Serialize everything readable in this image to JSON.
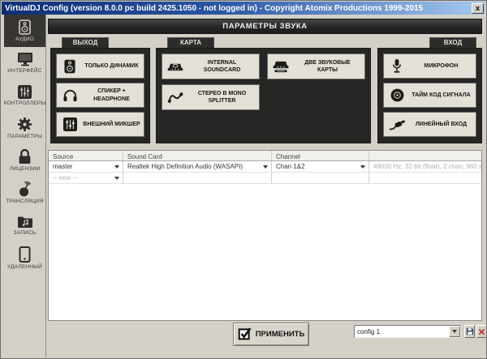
{
  "window": {
    "title": "VirtualDJ Config (version 8.0.0 pc build 2425.1050 - not logged in) - Copyright Atomix Productions 1999-2015",
    "close": "x"
  },
  "header": {
    "title": "ПАРАМЕТРЫ ЗВУКА"
  },
  "sidebar": {
    "items": [
      {
        "label": "АУДИО",
        "icon": "speaker-icon",
        "selected": true
      },
      {
        "label": "ИНТЕРФЕЙС",
        "icon": "monitor-icon",
        "selected": false
      },
      {
        "label": "КОНТРОЛЛЕРЫ",
        "icon": "mixer-icon",
        "selected": false
      },
      {
        "label": "ПАРАМЕТРЫ",
        "icon": "gear-icon",
        "selected": false
      },
      {
        "label": "ЛИЦЕНЗИИ",
        "icon": "lock-icon",
        "selected": false
      },
      {
        "label": "ТРАНСЛЯЦИЯ",
        "icon": "broadcast-icon",
        "selected": false
      },
      {
        "label": "ЗАПИСЬ",
        "icon": "record-icon",
        "selected": false
      },
      {
        "label": "УДАЛЕННЫЙ",
        "icon": "remote-icon",
        "selected": false
      }
    ]
  },
  "sections": {
    "output": {
      "tab": "ВЫХОД",
      "buttons": [
        {
          "label": "ТОЛЬКО ДИНАМИК",
          "icon": "speaker-icon"
        },
        {
          "label": "СПИКЕР +\nHEADPHONE",
          "icon": "headphone-icon"
        },
        {
          "label": "ВНЕШНИЙ МИКШЕР",
          "icon": "mixer-icon"
        }
      ]
    },
    "card": {
      "tab": "КАРТА",
      "buttons": [
        {
          "label": "INTERNAL\nSOUNDCARD",
          "icon": "soundcard-icon"
        },
        {
          "label": "ДВЕ ЗВУКОВЫЕ КАРТЫ",
          "icon": "two-soundcards-icon"
        },
        {
          "label": "СТЕРЕО В MONO\nSPLITTER",
          "icon": "splitter-cable-icon"
        }
      ]
    },
    "input": {
      "tab": "ВХОД",
      "buttons": [
        {
          "label": "МИКРОФОН",
          "icon": "microphone-icon"
        },
        {
          "label": "ТАЙМ КОД СИГНАЛА",
          "icon": "vinyl-icon"
        },
        {
          "label": "ЛИНЕЙНЫЙ ВХОД",
          "icon": "line-in-icon"
        }
      ]
    }
  },
  "table": {
    "columns": [
      "Source",
      "Sound Card",
      "Channel",
      ""
    ],
    "rows": [
      {
        "source": "master",
        "sound_card": "Realtek High Definition Audio (WASAPI)",
        "channel": "Chan 1&2",
        "info": "48000 Hz, 32-bit (float), 2 chan, 960 s"
      },
      {
        "source": "-- new --",
        "sound_card": "",
        "channel": "",
        "info": ""
      }
    ]
  },
  "footer": {
    "apply": "ПРИМЕНИТЬ",
    "config": "config 1"
  },
  "colors": {
    "titlebar_left": "#0c2e76",
    "titlebar_right": "#a6caf0",
    "window_face": "#d4d0c8",
    "panel_dark": "#262624",
    "button_face": "#e3e0d7",
    "selected_dark": "#383634",
    "muted_text": "#b3b1ac",
    "delete_red": "#b23b3b"
  }
}
